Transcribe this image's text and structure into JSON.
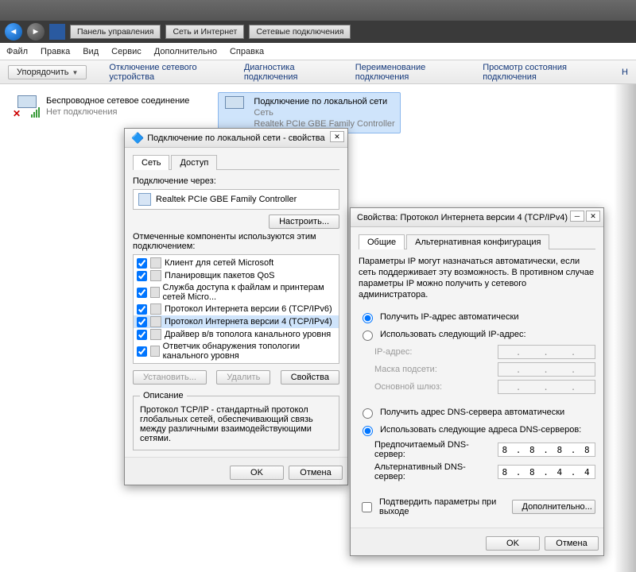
{
  "breadcrumb": [
    "Панель управления",
    "Сеть и Интернет",
    "Сетевые подключения"
  ],
  "menubar": [
    "Файл",
    "Правка",
    "Вид",
    "Сервис",
    "Дополнительно",
    "Справка"
  ],
  "toolbar": {
    "organize": "Упорядочить",
    "items": [
      "Отключение сетевого устройства",
      "Диагностика подключения",
      "Переименование подключения",
      "Просмотр состояния подключения",
      "Н"
    ]
  },
  "connections": {
    "wifi": {
      "title": "Беспроводное сетевое соединение",
      "status": "Нет подключения"
    },
    "lan": {
      "title": "Подключение по локальной сети",
      "sub1": "Сеть",
      "sub2": "Realtek PCIe GBE Family Controller"
    }
  },
  "dlg1": {
    "title": "Подключение по локальной сети - свойства",
    "tab_net": "Сеть",
    "tab_access": "Доступ",
    "connect_via": "Подключение через:",
    "adapter": "Realtek PCIe GBE Family Controller",
    "configure": "Настроить...",
    "components_label": "Отмеченные компоненты используются этим подключением:",
    "components": [
      "Клиент для сетей Microsoft",
      "Планировщик пакетов QoS",
      "Служба доступа к файлам и принтерам сетей Micro...",
      "Протокол Интернета версии 6 (TCP/IPv6)",
      "Протокол Интернета версии 4 (TCP/IPv4)",
      "Драйвер в/в тополога канального уровня",
      "Ответчик обнаружения топологии канального уровня"
    ],
    "selected_index": 4,
    "install": "Установить...",
    "uninstall": "Удалить",
    "properties": "Свойства",
    "desc_legend": "Описание",
    "desc_text": "Протокол TCP/IP - стандартный протокол глобальных сетей, обеспечивающий связь между различными взаимодействующими сетями.",
    "ok": "OK",
    "cancel": "Отмена"
  },
  "dlg2": {
    "title": "Свойства: Протокол Интернета версии 4 (TCP/IPv4)",
    "tab_general": "Общие",
    "tab_alt": "Альтернативная конфигурация",
    "blurb": "Параметры IP могут назначаться автоматически, если сеть поддерживает эту возможность. В противном случае параметры IP можно получить у сетевого администратора.",
    "ip_auto": "Получить IP-адрес автоматически",
    "ip_manual": "Использовать следующий IP-адрес:",
    "ip_addr_lbl": "IP-адрес:",
    "mask_lbl": "Маска подсети:",
    "gw_lbl": "Основной шлюз:",
    "dns_auto": "Получить адрес DNS-сервера автоматически",
    "dns_manual": "Использовать следующие адреса DNS-серверов:",
    "dns1_lbl": "Предпочитаемый DNS-сервер:",
    "dns1_val": "8 . 8 . 8 . 8",
    "dns2_lbl": "Альтернативный DNS-сервер:",
    "dns2_val": "8 . 8 . 4 . 4",
    "confirm_exit": "Подтвердить параметры при выходе",
    "advanced": "Дополнительно...",
    "ok": "OK",
    "cancel": "Отмена"
  }
}
